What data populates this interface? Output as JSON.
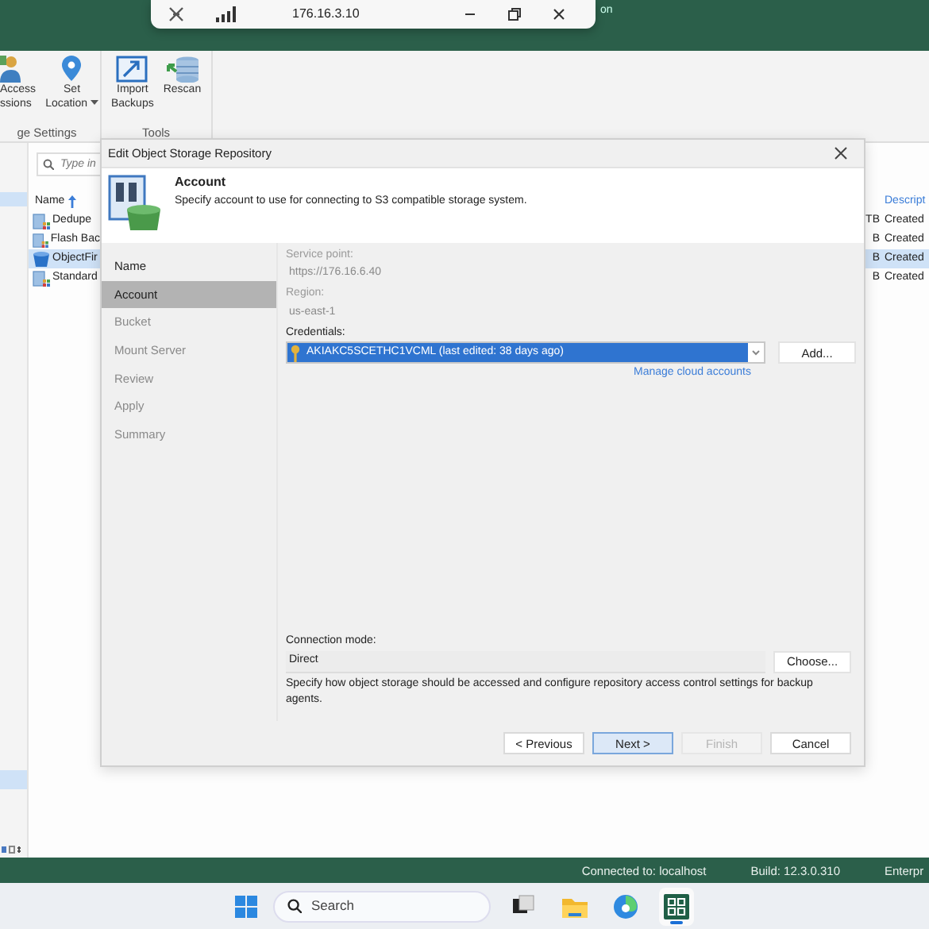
{
  "remote_bar": {
    "address": "176.16.3.10"
  },
  "app_title": "on",
  "ribbon": {
    "groups": [
      {
        "label": "ge Settings",
        "buttons": [
          {
            "lines": [
              "Access",
              "ssions"
            ],
            "kind": "person",
            "dropdown": false
          },
          {
            "lines": [
              "Set",
              "Location"
            ],
            "kind": "pin",
            "dropdown": true
          }
        ]
      },
      {
        "label": "Tools",
        "buttons": [
          {
            "lines": [
              "Import",
              "Backups"
            ],
            "kind": "import",
            "dropdown": false
          },
          {
            "lines": [
              "Rescan"
            ],
            "kind": "rescan",
            "dropdown": false
          }
        ]
      }
    ]
  },
  "search": {
    "placeholder": "Type in"
  },
  "table": {
    "columns": [
      "Name",
      "Descript"
    ],
    "rows": [
      {
        "name": "Dedupe",
        "size": "TB",
        "description": "Created",
        "selected": false,
        "kind": "dedupe"
      },
      {
        "name": "Flash Bac",
        "size": "B",
        "description": "Created",
        "selected": false,
        "kind": "dedupe"
      },
      {
        "name": "ObjectFir",
        "size": "B",
        "description": "Created",
        "selected": true,
        "kind": "bucket"
      },
      {
        "name": "Standard",
        "size": "B",
        "description": "Created",
        "selected": false,
        "kind": "dedupe"
      }
    ]
  },
  "dialog": {
    "title": "Edit Object Storage Repository",
    "heading": "Account",
    "subheading": "Specify account to use for connecting to S3 compatible storage system.",
    "steps": [
      {
        "label": "Name",
        "selected": false,
        "disabled": false
      },
      {
        "label": "Account",
        "selected": true,
        "disabled": false
      },
      {
        "label": "Bucket",
        "selected": false,
        "disabled": true
      },
      {
        "label": "Mount Server",
        "selected": false,
        "disabled": true
      },
      {
        "label": "Review",
        "selected": false,
        "disabled": true
      },
      {
        "label": "Apply",
        "selected": false,
        "disabled": true
      },
      {
        "label": "Summary",
        "selected": false,
        "disabled": true
      }
    ],
    "fields": [
      {
        "label": "Service point:",
        "value": "https://176.16.6.40",
        "disabled": true
      },
      {
        "label": "Region:",
        "value": "us-east-1",
        "disabled": true
      }
    ],
    "credentials": {
      "label": "Credentials:",
      "value": "AKIAKC5SCETHC1VCML (last edited: 38 days ago)",
      "add": "Add...",
      "manage_link": "Manage cloud accounts"
    },
    "connection": {
      "label": "Connection mode:",
      "value": "Direct",
      "choose": "Choose...",
      "hint": "Specify how object storage should be accessed and configure repository access control settings for backup agents."
    },
    "buttons": [
      {
        "label": "< Previous",
        "default": false,
        "disabled": false
      },
      {
        "label": "Next >",
        "default": true,
        "disabled": false
      },
      {
        "label": "Finish",
        "default": false,
        "disabled": true
      },
      {
        "label": "Cancel",
        "default": false,
        "disabled": false
      }
    ]
  },
  "status_bar": [
    "Connected to: localhost",
    "Build: 12.3.0.310",
    "Enterpr"
  ],
  "taskbar": {
    "search": "Search",
    "apps": [
      {
        "kind": "taskview",
        "active": false
      },
      {
        "kind": "explorer",
        "active": false
      },
      {
        "kind": "edge",
        "active": false
      },
      {
        "kind": "veeam",
        "active": true
      }
    ]
  }
}
